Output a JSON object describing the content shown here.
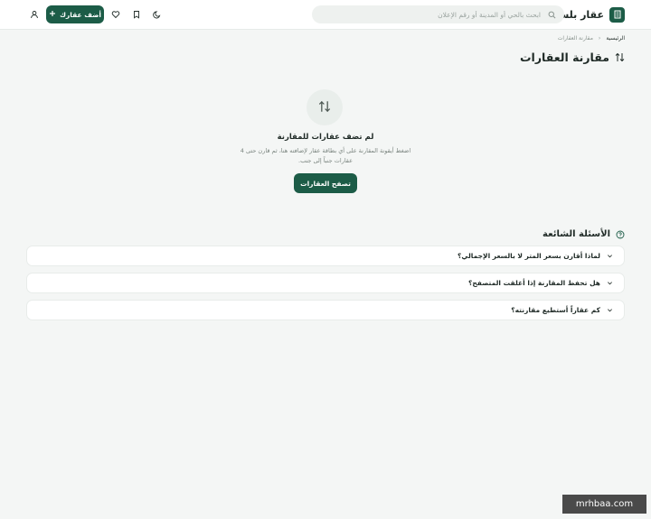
{
  "header": {
    "brand": "عقار بلس",
    "search_placeholder": "ابحث بالحي أو المدينة أو رقم الإعلان",
    "add_property_label": "أضف عقارك"
  },
  "breadcrumb": {
    "home": "الرئيسية",
    "separator": "‹",
    "current": "مقارنة العقارات"
  },
  "page": {
    "title": "مقارنة العقارات"
  },
  "empty_state": {
    "title": "لم تضف عقارات للمقارنة",
    "description": "اضغط أيقونة المقارنة على أي بطاقة عقار لإضافته هنا، ثم قارن حتى 4 عقارات جنباً إلى جنب.",
    "button_label": "تصفح العقارات"
  },
  "faq": {
    "title": "الأسئلة الشائعة",
    "items": [
      {
        "question": "لماذا أقارن بسعر المتر لا بالسعر الإجمالي؟"
      },
      {
        "question": "هل تحفظ المقارنة إذا أغلقت المتصفح؟"
      },
      {
        "question": "كم عقاراً أستطيع مقارنته؟"
      }
    ]
  },
  "watermark": "mrhbaa.com",
  "colors": {
    "accent": "#1c5c47",
    "background": "#f4f6f5",
    "card": "#ffffff"
  },
  "icons": {
    "brand": "building-icon",
    "search": "search-icon",
    "theme": "moon-icon",
    "saved": "bookmark-icon",
    "favorites": "heart-icon",
    "account": "user-icon",
    "compare": "compare-icon",
    "faq": "help-circle-icon"
  }
}
